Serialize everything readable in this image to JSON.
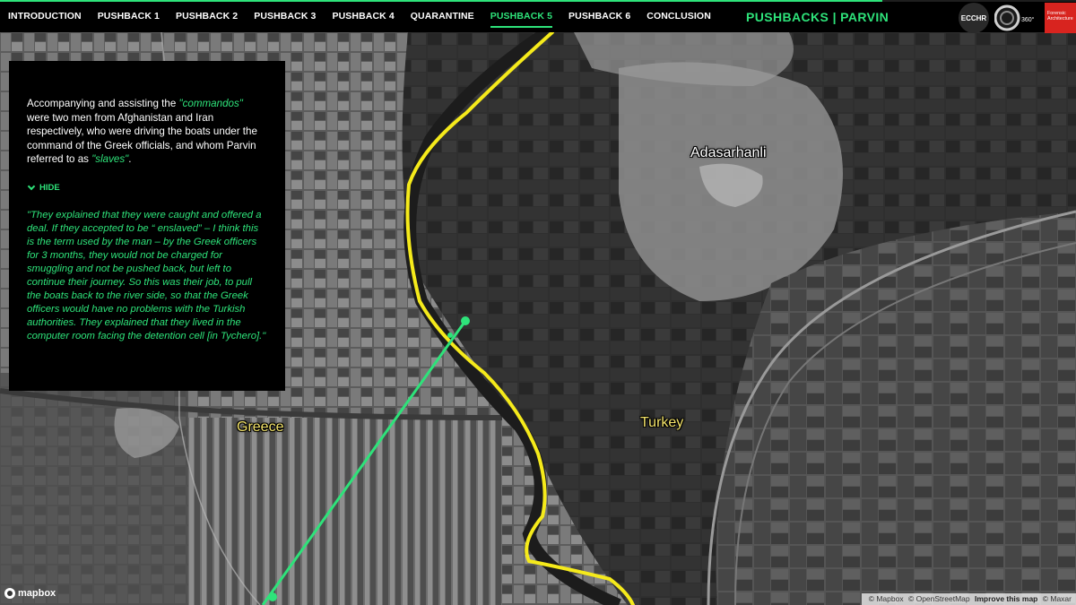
{
  "nav": {
    "items": [
      {
        "label": "INTRODUCTION",
        "active": false
      },
      {
        "label": "PUSHBACK 1",
        "active": false
      },
      {
        "label": "PUSHBACK 2",
        "active": false
      },
      {
        "label": "PUSHBACK 3",
        "active": false
      },
      {
        "label": "PUSHBACK 4",
        "active": false
      },
      {
        "label": "QUARANTINE",
        "active": false
      },
      {
        "label": "PUSHBACK 5",
        "active": true
      },
      {
        "label": "PUSHBACK 6",
        "active": false
      },
      {
        "label": "CONCLUSION",
        "active": false
      }
    ],
    "progress_fraction": 0.82
  },
  "header": {
    "title": "PUSHBACKS | PARVIN",
    "logos": {
      "ecchr": "ECCHR",
      "mobile360": "360°",
      "forensic_architecture": "Forensic Architecture"
    }
  },
  "panel": {
    "text_before": "Accompanying and assisting the ",
    "highlight_1": "\"commandos\"",
    "text_middle": " were two men from Afghanistan and Iran respectively, who were driving the boats under the command of the Greek officials, and whom Parvin referred to as ",
    "highlight_2": "\"slaves\"",
    "text_after": ".",
    "toggle_label": "HIDE",
    "testimony": "\"They explained that they were caught and offered a deal. If they accepted to be “ enslaved” – I think this is the term used by the man – by the Greek officers for 3 months, they would not be charged for smuggling and not be pushed back, but left to continue their journey. So this was their job, to pull the boats back to the river side, so that the Greek officers would have no problems with the Turkish authorities. They explained that they lived in the computer room facing the detention cell [in Tychero].\""
  },
  "map": {
    "labels": {
      "village": "Adasarhanli",
      "country_west": "Greece",
      "country_east": "Turkey"
    },
    "border_color": "#f5ea1b",
    "route_color": "#2ee37a"
  },
  "attribution": {
    "brand": "mapbox",
    "mapbox": "© Mapbox",
    "osm": "© OpenStreetMap",
    "improve": "Improve this map",
    "maxar": "© Maxar"
  },
  "colors": {
    "accent": "#2ee37a",
    "forensic_red": "#d8241f"
  }
}
